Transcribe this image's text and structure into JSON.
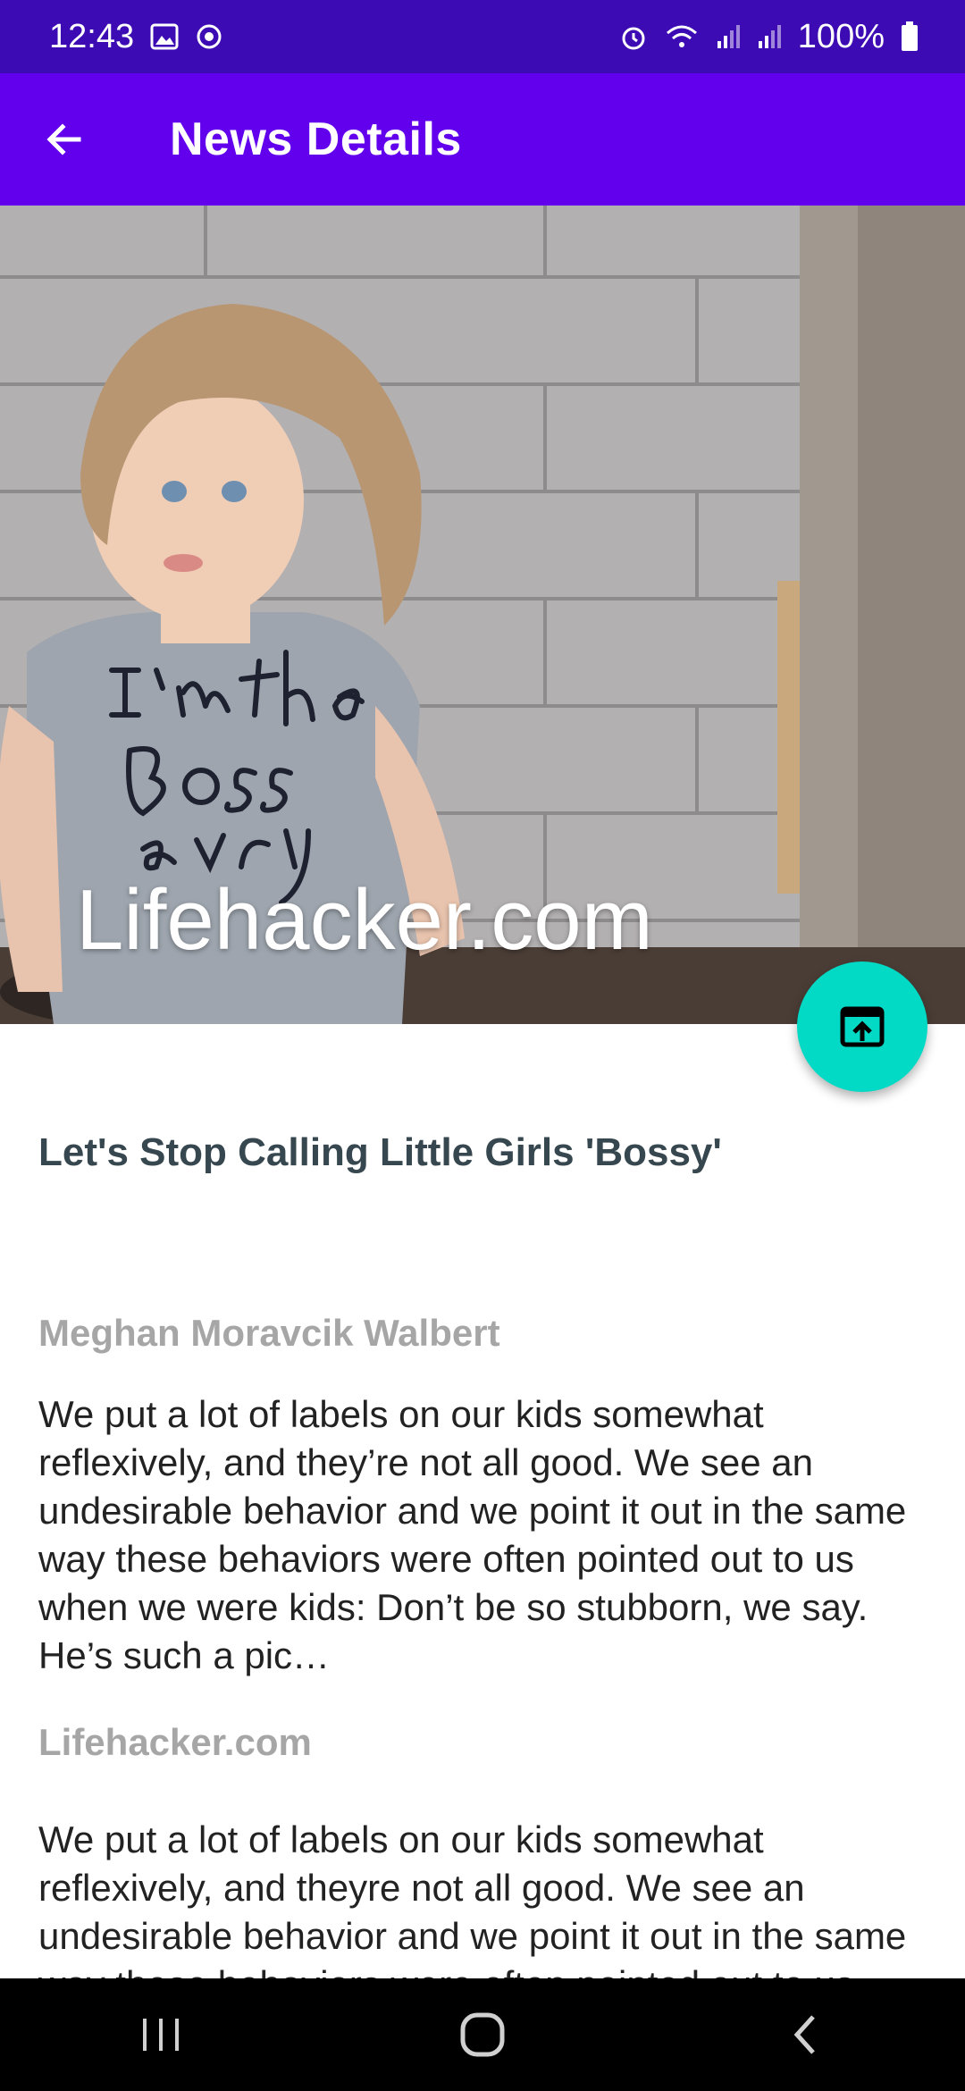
{
  "status_bar": {
    "time": "12:43",
    "battery": "100%",
    "icons": [
      "gallery-icon",
      "sync-icon",
      "alarm-icon",
      "wifi-icon",
      "signal-icon",
      "signal-icon",
      "battery-icon"
    ]
  },
  "app_bar": {
    "title": "News Details",
    "back_icon": "arrow-back-icon"
  },
  "hero": {
    "source_overlay": "Lifehacker.com",
    "open_button_icon": "open-in-browser-icon"
  },
  "article": {
    "title": "Let's Stop Calling Little Girls 'Bossy'",
    "author": "Meghan Moravcik Walbert",
    "description": "We put a lot of labels on our kids somewhat reflexively, and they’re not all good. We see an undesirable behavior and we point it out in the same way these behaviors were often pointed out to us when we were kids: Don’t be so stubborn, we say. He’s such a pic…",
    "source": "Lifehacker.com",
    "content": "We put a lot of labels on our kids somewhat reflexively, and theyre not all good. We see an undesirable behavior and we point it out in the same way these behaviors were often pointed out to us when we were kids"
  },
  "nav_bar": {
    "buttons": [
      "recents-icon",
      "home-icon",
      "back-icon"
    ]
  },
  "colors": {
    "status_bar": "#3d0bb3",
    "app_bar": "#6200ee",
    "fab": "#03dac5",
    "headline": "#37474f",
    "muted": "#a6a6a6"
  }
}
